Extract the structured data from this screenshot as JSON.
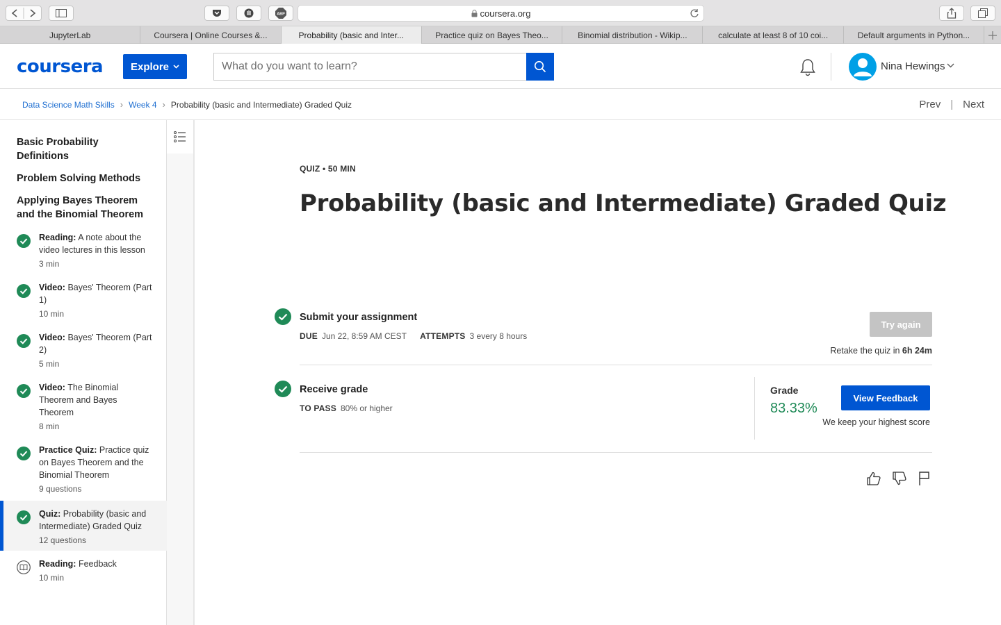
{
  "browser": {
    "url": "coursera.org",
    "tabs": [
      {
        "label": "JupyterLab",
        "active": false
      },
      {
        "label": "Coursera | Online Courses &...",
        "active": false
      },
      {
        "label": "Probability (basic and Inter...",
        "active": true
      },
      {
        "label": "Practice quiz on Bayes Theo...",
        "active": false
      },
      {
        "label": "Binomial distribution - Wikip...",
        "active": false
      },
      {
        "label": "calculate at least 8 of 10 coi...",
        "active": false
      },
      {
        "label": "Default arguments in Python...",
        "active": false
      }
    ]
  },
  "header": {
    "logo": "coursera",
    "explore_label": "Explore",
    "search_placeholder": "What do you want to learn?",
    "user_name": "Nina Hewings"
  },
  "breadcrumb": {
    "items": [
      "Data Science Math Skills",
      "Week 4"
    ],
    "current": "Probability (basic and Intermediate) Graded Quiz",
    "prev": "Prev",
    "next": "Next"
  },
  "sidebar": {
    "sections": [
      "Basic Probability Definitions",
      "Problem Solving Methods",
      "Applying Bayes Theorem and the Binomial Theorem"
    ],
    "items": [
      {
        "type": "Reading:",
        "title": "A note about the video lectures in this lesson",
        "meta": "3 min",
        "status": "complete"
      },
      {
        "type": "Video:",
        "title": "Bayes' Theorem (Part 1)",
        "meta": "10 min",
        "status": "complete"
      },
      {
        "type": "Video:",
        "title": "Bayes' Theorem (Part 2)",
        "meta": "5 min",
        "status": "complete"
      },
      {
        "type": "Video:",
        "title": "The Binomial Theorem and Bayes Theorem",
        "meta": "8 min",
        "status": "complete"
      },
      {
        "type": "Practice Quiz:",
        "title": "Practice quiz on Bayes Theorem and the Binomial Theorem",
        "meta": "9 questions",
        "status": "complete"
      },
      {
        "type": "Quiz:",
        "title": "Probability (basic and Intermediate) Graded Quiz",
        "meta": "12 questions",
        "status": "complete"
      },
      {
        "type": "Reading:",
        "title": "Feedback",
        "meta": "10 min",
        "status": "not-started"
      }
    ]
  },
  "main": {
    "quiz_tag": "QUIZ • 50 MIN",
    "title": "Probability (basic and Intermediate) Graded Quiz",
    "submit": {
      "title": "Submit your assignment",
      "due_label": "DUE",
      "due_value": "Jun 22, 8:59 AM CEST",
      "attempts_label": "ATTEMPTS",
      "attempts_value": "3 every 8 hours",
      "try_again": "Try again",
      "retake_prefix": "Retake the quiz in",
      "retake_time": "6h 24m"
    },
    "receive": {
      "title": "Receive grade",
      "topass_label": "TO PASS",
      "topass_value": "80% or higher",
      "grade_label": "Grade",
      "grade_value": "83.33%",
      "view_feedback": "View Feedback",
      "highest_note": "We keep your highest score"
    }
  },
  "colors": {
    "brand": "#0056d2",
    "success": "#1f8a57",
    "disabled": "#c4c4c4"
  }
}
